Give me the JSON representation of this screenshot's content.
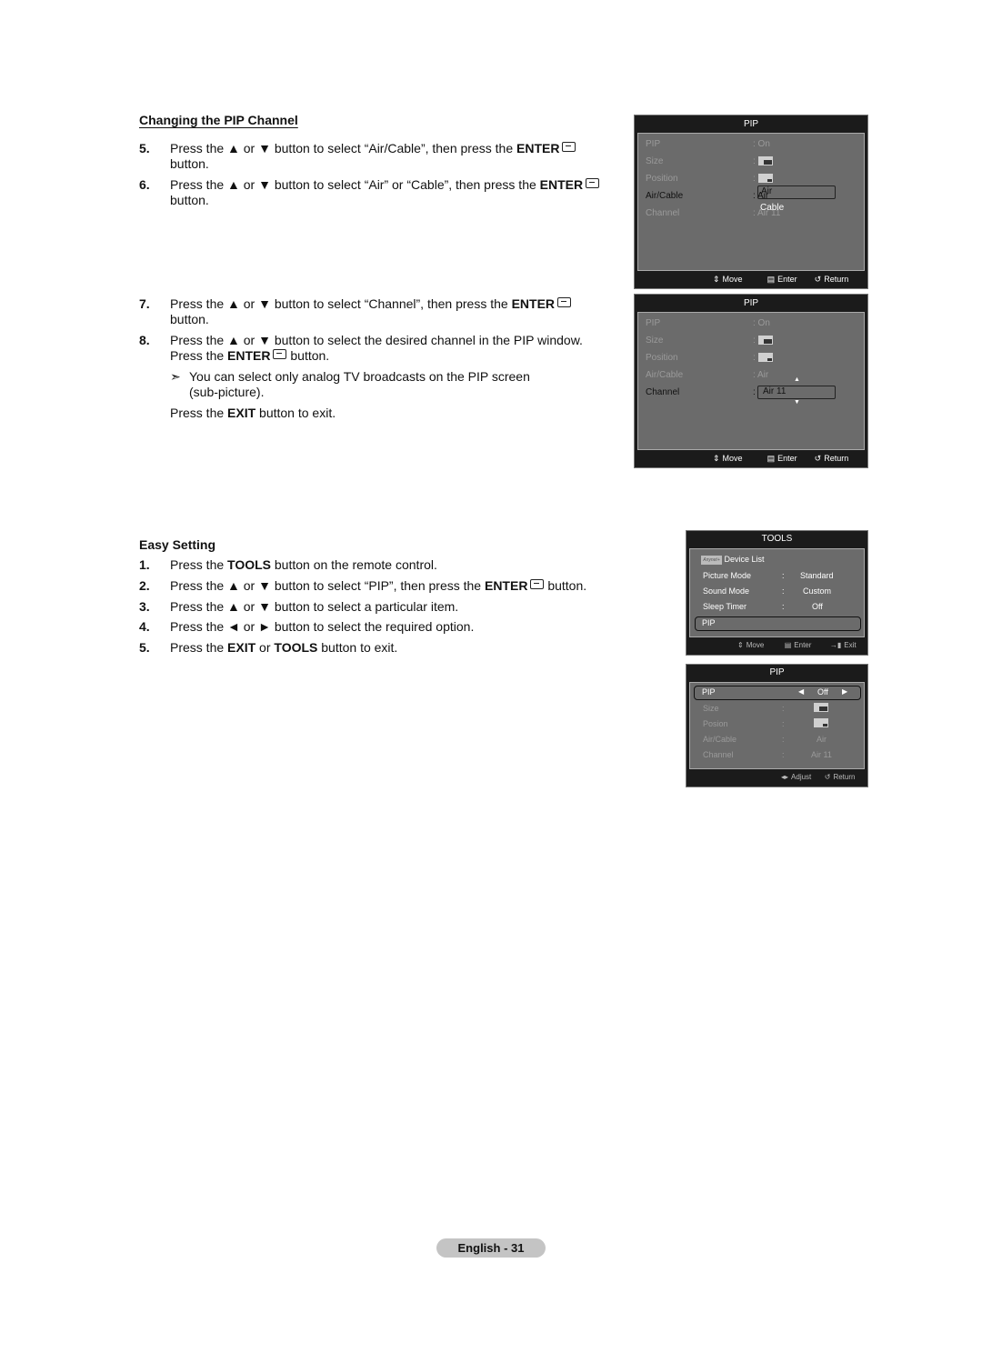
{
  "section1": {
    "title": "Changing the PIP Channel",
    "steps": [
      {
        "num": "5.",
        "pre": "Press the ▲ or ▼ button to select “Air/Cable”, then press the ",
        "bold": "ENTER",
        "post": "",
        "line2": "button."
      },
      {
        "num": "6.",
        "pre": "Press the ▲ or ▼ button to select “Air” or “Cable”, then press the ",
        "bold": "ENTER",
        "post": "",
        "line2": "button."
      },
      {
        "num": "7.",
        "pre": "Press the ▲ or ▼ button to select “Channel”, then press the ",
        "bold": "ENTER",
        "post": "",
        "line2": "button."
      },
      {
        "num": "8.",
        "pre": "Press the ▲ or ▼ button to select the desired channel in the PIP window.",
        "line2_pre": "Press the ",
        "line2_bold": "ENTER",
        "line2_post": " button."
      }
    ],
    "note_arrow": "➣",
    "note": "You can select only analog TV broadcasts on the PIP screen (sub-picture).",
    "exit_pre": "Press the ",
    "exit_bold": "EXIT",
    "exit_post": " button to exit."
  },
  "osd1": {
    "title": "PIP",
    "rows": [
      {
        "label": "PIP",
        "value": ": On"
      },
      {
        "label": "Size",
        "value": ":"
      },
      {
        "label": "Position",
        "value": ":"
      },
      {
        "label": "Air/Cable",
        "value": ": Air"
      },
      {
        "label": "Channel",
        "value": ": Air 11"
      }
    ],
    "dropdown_options": [
      "Air",
      "Cable"
    ],
    "footer": {
      "move": "Move",
      "enter": "Enter",
      "return": "Return"
    }
  },
  "osd2": {
    "title": "PIP",
    "rows": [
      {
        "label": "PIP",
        "value": ": On"
      },
      {
        "label": "Size",
        "value": ":"
      },
      {
        "label": "Position",
        "value": ":"
      },
      {
        "label": "Air/Cable",
        "value": ": Air"
      },
      {
        "label": "Channel",
        "value": ": Air 11"
      }
    ],
    "channel_value": "Air 11",
    "footer": {
      "move": "Move",
      "enter": "Enter",
      "return": "Return"
    }
  },
  "section2": {
    "title": "Easy Setting",
    "steps": [
      {
        "num": "1.",
        "pre": "Press the ",
        "bold": "TOOLS",
        "post": " button on the remote control."
      },
      {
        "num": "2.",
        "pre": "Press the ▲ or ▼ button to select “PIP”, then press the ",
        "bold": "ENTER",
        "post": " button."
      },
      {
        "num": "3.",
        "pre": "Press the ▲ or ▼ button to select a particular item."
      },
      {
        "num": "4.",
        "pre": "Press the ◄ or ► button to select the required option."
      },
      {
        "num": "5.",
        "pre": "Press the ",
        "bold": "EXIT",
        "mid": " or ",
        "bold2": "TOOLS",
        "post": " button to exit."
      }
    ]
  },
  "tools": {
    "title": "TOOLS",
    "device_list": "Device List",
    "anynet_logo": "Anynet+",
    "rows": [
      {
        "label": "Picture Mode",
        "sep": ":",
        "value": "Standard"
      },
      {
        "label": "Sound Mode",
        "sep": ":",
        "value": "Custom"
      },
      {
        "label": "Sleep Timer",
        "sep": ":",
        "value": "Off"
      },
      {
        "label": "PIP",
        "sep": "",
        "value": ""
      }
    ],
    "footer": {
      "move": "Move",
      "enter": "Enter",
      "exit": "Exit"
    }
  },
  "osd3": {
    "title": "PIP",
    "pip_label": "PIP",
    "pip_value": "Off",
    "rows": [
      {
        "label": "Size",
        "sep": ":",
        "value": ""
      },
      {
        "label": "Posion",
        "sep": ":",
        "value": ""
      },
      {
        "label": "Air/Cable",
        "sep": ":",
        "value": "Air"
      },
      {
        "label": "Channel",
        "sep": ":",
        "value": "Air 11"
      }
    ],
    "footer": {
      "adjust": "Adjust",
      "return": "Return"
    }
  },
  "page_label": "English - 31"
}
